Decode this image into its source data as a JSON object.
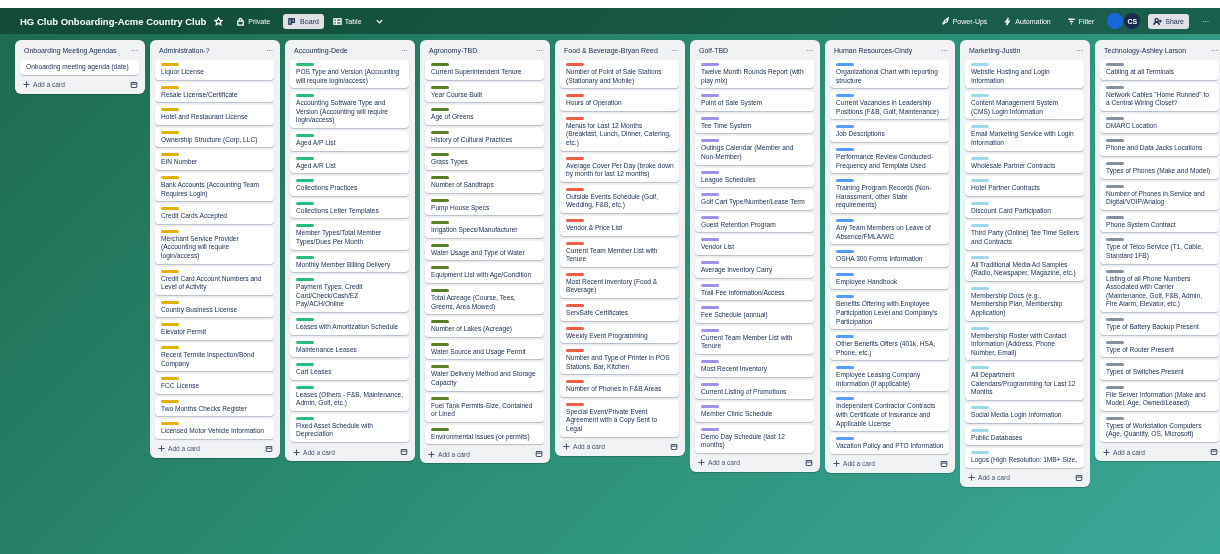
{
  "board": {
    "title": "HG Club Onboarding-Acme Country Club",
    "visibility": "Private",
    "tabs": [
      {
        "label": "Board",
        "selected": true
      },
      {
        "label": "Table",
        "selected": false
      }
    ],
    "actions": [
      "Power-Ups",
      "Automation",
      "Filter"
    ],
    "members": [
      {
        "color": "#1868db"
      },
      {
        "initials": "CS",
        "color": "#172b4d"
      }
    ],
    "share": "Share",
    "more": "···"
  },
  "lists": [
    {
      "title": "Onboarding Meeting Agendas",
      "menu": "···",
      "add_card": "Add a card",
      "cards": [
        "Onboarding meeting agenda (date)"
      ]
    },
    {
      "title": "Administration-?",
      "menu": "···",
      "add_card": "Add a card",
      "color": "#e2b203",
      "cards": [
        "Liquor License",
        "Resale License/Certificate",
        "Hotel and Restaurant License",
        "Ownership Structure (Corp, LLC)",
        "EIN Number",
        "Bank Accounts (Accounting Team Requires Login)",
        "Credit Cards Accepted",
        "Merchant Service Provider (Accounting will require login/access)",
        "Credit Card Account Numbers and Level of Activity",
        "Country Business License",
        "Elevator Permit",
        "Recent Termite Inspection/Bond Company",
        "FCC License",
        "Two Months Checks Register",
        "Licensed Motor Vehicle Information"
      ]
    },
    {
      "title": "Accounting-Dede",
      "menu": "···",
      "add_card": "Add a card",
      "color": "#2abb7f",
      "cards": [
        "POS Type and Version (Accounting will require login/access)",
        "Accounting Software Type and Version (Accounting will require login/access)",
        "Aged A/P List",
        "Aged A/R List",
        "Collections Practices",
        "Collections Letter Templates",
        "Member Types/Total Member Types/Dues Per Month",
        "Monthly Member Billing Delivery",
        "Payment Types: Credit Card/Check/Cash/EZ Pay/ACH/Online",
        "Leases with Amortization Schedule",
        "Maintenance Leases",
        "Cart Leases",
        "Leases (Others - F&B, Maintenance, Admin, Golf, etc.)",
        "Fixed Asset Schedule with Depreciation"
      ]
    },
    {
      "title": "Agronomy-TBD",
      "menu": "···",
      "add_card": "Add a card",
      "color": "#5b7f24",
      "cards": [
        "Current Superintendent Tenure",
        "Year Course Built",
        "Age of Greens",
        "History of Cultural Practices",
        "Grass Types",
        "Number of Sandtraps",
        "Pump House Specs",
        "Irrigation Specs/Manufacturer",
        "Water Usage and Type of Water",
        "Equipment List with Age/Condition",
        "Total Acreage (Course, Tees, Greens, Area Mowed)",
        "Number of Lakes (Acreage)",
        "Water Source and Usage Permit",
        "Water Delivery Method and Storage Capacity",
        "Fuel Tank Permits-Size, Contained or Lined",
        "Environmental Issues (or permits)"
      ]
    },
    {
      "title": "Food & Beverage-Bryan Reed",
      "menu": "···",
      "add_card": "Add a card",
      "color": "#f15c48",
      "cards": [
        "Number of Point of Sale Stations (Stationary and Mobile)",
        "Hours of Operation",
        "Menus for Last 12 Months (Breakfast, Lunch, Dinner, Catering, etc.)",
        "Average Cover Per Day (broke down by month for last 12 months)",
        "Outside Events Schedule (Golf, Wedding, F&B, etc.)",
        "Vendor & Price List",
        "Current Team Member List with Tenure",
        "Most Recent Inventory (Food & Beverage)",
        "ServSafe Certificates",
        "Weekly Event Programming",
        "Number and Type of Printer in POS Stations, Bar, Kitchen",
        "Number of Phones in F&B Areas",
        "Special Event/Private Event Agreement with a Copy Sent to Legal"
      ]
    },
    {
      "title": "Golf-TBD",
      "menu": "···",
      "add_card": "Add a card",
      "color": "#9f8fef",
      "cards": [
        "Twelve Month Rounds Report (with play mix)",
        "Point of Sale System",
        "Tee Time System",
        "Outings Calendar (Member and Non-Member)",
        "League Schedules",
        "Golf Cart Type/Number/Lease Term",
        "Guest Retention Program",
        "Vendor List",
        "Average Inventory Carry",
        "Trail Fee Information/Access",
        "Fee Schedule (annual)",
        "Current Team Member List with Tenure",
        "Most Recent Inventory",
        "Current Listing of Promotions",
        "Member Clinic Schedule",
        "Demo Day Schedule (last 12 months)"
      ]
    },
    {
      "title": "Human Resources-Cindy",
      "menu": "···",
      "add_card": "Add a card",
      "color": "#579dff",
      "cards": [
        "Organizational Chart with reporting structure",
        "Current Vacancies in Leadership Positions (F&B, Golf, Maintenance)",
        "Job Descriptions",
        "Performance Review Conducted-Frequency and Template Used",
        "Training Program Records (Non-Harassment, other State requirements)",
        "Any Team Members on Leave of Absence/FMLA/WC",
        "OSHA 300 Forms Information",
        "Employee Handbook",
        "Benefits Offering with Employee Participation Level and Company's Participation",
        "Other Benefits Offers (401k, HSA, Phone, etc.)",
        "Employee Leasing Company Information (if applicable)",
        "Independent Contractor Contracts with Certificate of Insurance and Applicable License",
        "Vacation Policy and PTO Information"
      ]
    },
    {
      "title": "Marketing-Justin",
      "menu": "···",
      "add_card": "Add a card",
      "color": "#9dd9ee",
      "cards": [
        "Website Hosting and Login Information",
        "Content Management System (CMS) Login Information",
        "Email Marketing Service with Login Information",
        "Wholesale Partner Contracts",
        "Hotel Partner Contracts",
        "Discount Card Participation",
        "Third Party (Online) Tee Time Sellers and Contracts",
        "All Traditional Media Ad Samples (Radio, Newspaper, Magazine, etc.)",
        "Membership Docs (e.g., Membership Plan, Membership Application)",
        "Membership Roster with Contact Information (Address, Phone Number, Email)",
        "All Department Calendars/Programming for Last 12 Months",
        "Social Media Login Information",
        "Public Databases",
        "Logos (High Resolution: 1MB+ Size,"
      ]
    },
    {
      "title": "Technology-Ashley Larson",
      "menu": "···",
      "add_card": "Add a card",
      "color": "#8590a2",
      "cards": [
        "Cabling at all Terminals",
        "Network Cables \"Home Runned\" to a Central Wiring Closet?",
        "DMARC Location",
        "Phone and Data Jacks Locations",
        "Types of Phones (Make and Model)",
        "Number of Phones in Service and Digital/VOIP/Analog",
        "Phone System Contract",
        "Type of Telco Service (T1, Cable, Standard 1FB)",
        "Listing of all Phone Numbers Associated with Carrier (Maintenance, Golf, F&B, Admin, Fire Alarm, Elevator, etc.)",
        "Type of Battery Backup Present",
        "Type of Router Present",
        "Types of Switches Present",
        "File Server Information (Make and Model, Age, Owned/Leased)",
        "Types of Workstation Computers (Age, Quantity, OS, Microsoft)"
      ]
    }
  ]
}
